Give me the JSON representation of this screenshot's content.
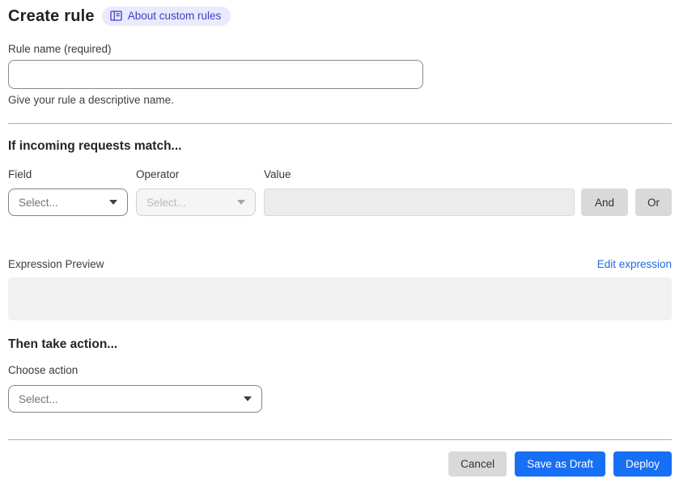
{
  "header": {
    "title": "Create rule",
    "about_link": "About custom rules"
  },
  "rule_name": {
    "label": "Rule name (required)",
    "value": "",
    "helper": "Give your rule a descriptive name."
  },
  "match_section": {
    "heading": "If incoming requests match...",
    "field": {
      "label": "Field",
      "placeholder": "Select...",
      "enabled": true
    },
    "operator": {
      "label": "Operator",
      "placeholder": "Select...",
      "enabled": false
    },
    "value": {
      "label": "Value",
      "value": "",
      "enabled": false
    },
    "and_button": "And",
    "or_button": "Or"
  },
  "expression": {
    "label": "Expression Preview",
    "edit_link": "Edit expression",
    "preview": ""
  },
  "action_section": {
    "heading": "Then take action...",
    "choose_label": "Choose action",
    "placeholder": "Select..."
  },
  "footer": {
    "cancel": "Cancel",
    "save_draft": "Save as Draft",
    "deploy": "Deploy"
  },
  "icons": {
    "about_badge": "book-icon",
    "selects": "caret-down-icon"
  },
  "colors": {
    "primary_blue": "#166ff5",
    "link_blue": "#2268dd",
    "badge_bg": "#e9eafb",
    "badge_text": "#3c41c6",
    "divider": "#aeaeae",
    "btn_gray": "#d9d9d9",
    "panel_gray": "#f1f1f1"
  }
}
